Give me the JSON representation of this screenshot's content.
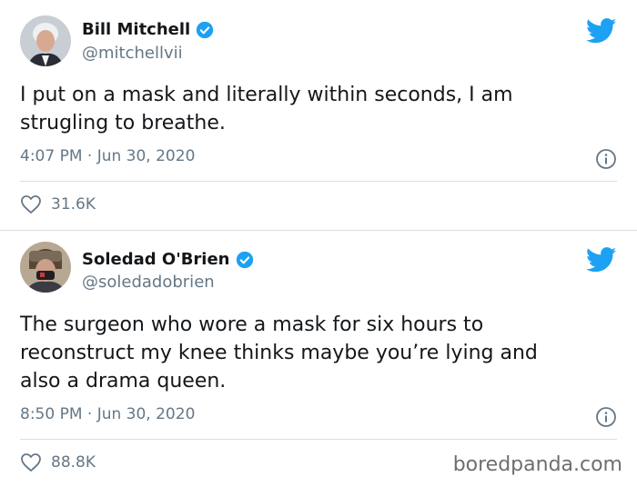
{
  "tweets": [
    {
      "name": "Bill Mitchell",
      "handle": "@mitchellvii",
      "text": "I put on a mask and literally within seconds, I am\nstrugling to breathe.",
      "timestamp": "4:07 PM · Jun 30, 2020",
      "likes": "31.6K"
    },
    {
      "name": "Soledad O'Brien",
      "handle": "@soledadobrien",
      "text": "The surgeon who wore a mask for six hours to\nreconstruct my knee thinks maybe you’re lying and\nalso a drama queen.",
      "timestamp": "8:50 PM · Jun 30, 2020",
      "likes": "88.8K"
    }
  ],
  "watermark": "boredpanda.com",
  "colors": {
    "twitter_blue": "#1da1f2",
    "secondary_text": "#657786",
    "divider": "#d8dee2"
  },
  "icons": [
    "verified-badge-icon",
    "twitter-bird-icon",
    "info-icon",
    "heart-icon"
  ]
}
